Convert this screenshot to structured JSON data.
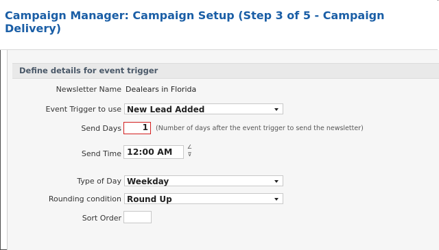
{
  "page": {
    "title": "Campaign Manager: Campaign Setup (Step 3 of 5 - Campaign Delivery)"
  },
  "section": {
    "title": "Define details for event trigger"
  },
  "form": {
    "newsletter_name": {
      "label": "Newsletter Name",
      "value": "Dealears in Florida"
    },
    "event_trigger": {
      "label": "Event Trigger to use",
      "value": "New Lead Added"
    },
    "send_days": {
      "label": "Send Days",
      "value": "1",
      "hint": "(Number of days after the event trigger to send the newsletter)"
    },
    "send_time": {
      "label": "Send Time",
      "value": "12:00 AM",
      "up_glyph": "∠",
      "down_glyph": "⊽"
    },
    "type_of_day": {
      "label": "Type of Day",
      "value": "Weekday"
    },
    "rounding_condition": {
      "label": "Rounding condition",
      "value": "Round Up"
    },
    "sort_order": {
      "label": "Sort Order",
      "value": ""
    }
  },
  "colors": {
    "title": "#1a5ea6",
    "section_header_bg": "#e9e9e9",
    "highlight_border": "#d21c1c"
  }
}
